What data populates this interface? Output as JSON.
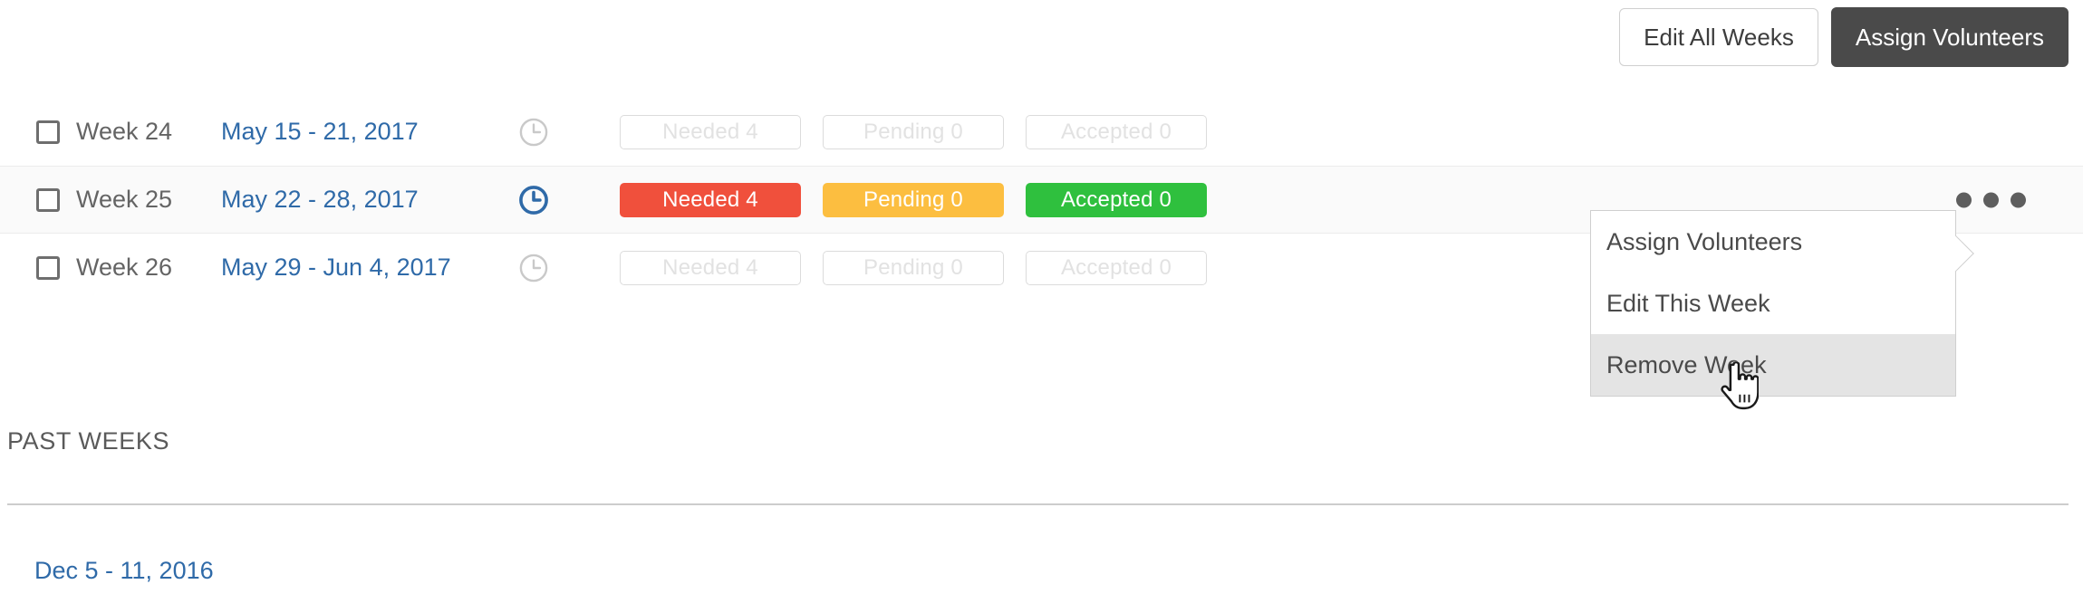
{
  "toolbar": {
    "edit_all_weeks_label": "Edit All Weeks",
    "assign_volunteers_label": "Assign Volunteers"
  },
  "colors": {
    "link": "#2f6aa8",
    "needed": "#f0503c",
    "pending": "#fcbe40",
    "accepted": "#2fc03e",
    "primary_button": "#4a4a4a",
    "active_row": "#fafafa",
    "menu_hover": "#e4e4e4",
    "muted_badge_text": "#e2e2e2"
  },
  "weeks": [
    {
      "checkbox_checked": false,
      "week_label": "Week 24",
      "date_range": "May 15 - 21, 2017",
      "clock_icon": "clock-icon",
      "clock_state": "inactive",
      "active": false,
      "badges": [
        {
          "label": "Needed 4",
          "type": "needed",
          "style": "muted"
        },
        {
          "label": "Pending 0",
          "type": "pending",
          "style": "muted"
        },
        {
          "label": "Accepted 0",
          "type": "accepted",
          "style": "muted"
        }
      ]
    },
    {
      "checkbox_checked": false,
      "week_label": "Week 25",
      "date_range": "May 22 - 28, 2017",
      "clock_icon": "clock-icon",
      "clock_state": "active",
      "active": true,
      "badges": [
        {
          "label": "Needed 4",
          "type": "needed",
          "style": "solid"
        },
        {
          "label": "Pending 0",
          "type": "pending",
          "style": "solid"
        },
        {
          "label": "Accepted 0",
          "type": "accepted",
          "style": "solid"
        }
      ]
    },
    {
      "checkbox_checked": false,
      "week_label": "Week 26",
      "date_range": "May 29 - Jun 4, 2017",
      "clock_icon": "clock-icon",
      "clock_state": "inactive",
      "active": false,
      "badges": [
        {
          "label": "Needed 4",
          "type": "needed",
          "style": "muted"
        },
        {
          "label": "Pending 0",
          "type": "pending",
          "style": "muted"
        },
        {
          "label": "Accepted 0",
          "type": "accepted",
          "style": "muted"
        }
      ]
    }
  ],
  "context_menu": {
    "visible": true,
    "anchor_week": "Week 25",
    "items": [
      {
        "label": "Assign Volunteers",
        "hovered": false
      },
      {
        "label": "Edit This Week",
        "hovered": false
      },
      {
        "label": "Remove Week",
        "hovered": true
      }
    ]
  },
  "past_weeks": {
    "heading": "PAST WEEKS",
    "rows": [
      {
        "date_range": "Dec 5 - 11, 2016"
      }
    ]
  },
  "cursor": {
    "icon": "pointer-hand-cursor"
  }
}
